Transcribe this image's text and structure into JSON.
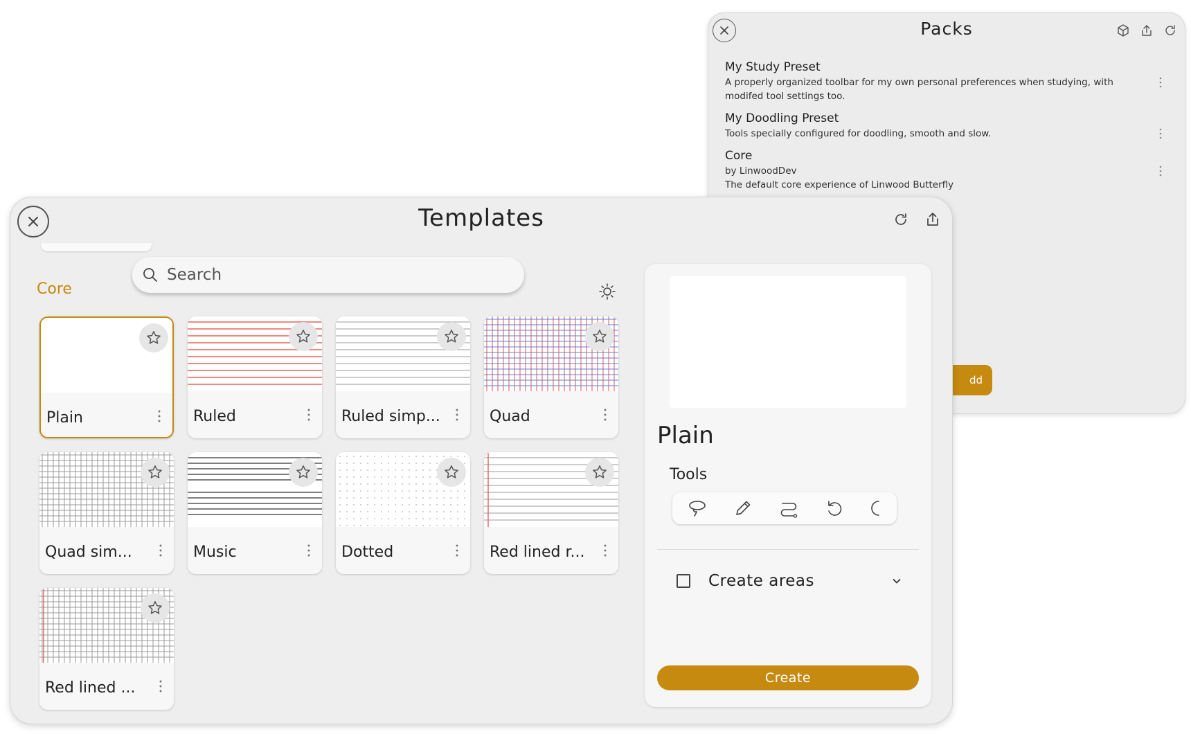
{
  "packs": {
    "title": "Packs",
    "items": [
      {
        "name": "My Study Preset",
        "lines": [
          "A properly organized toolbar for my own personal preferences when studying, with modifed tool settings too."
        ]
      },
      {
        "name": "My Doodling Preset",
        "lines": [
          "Tools specially configured for doodling, smooth and slow."
        ]
      },
      {
        "name": "Core",
        "lines": [
          "by LinwoodDev",
          "The default core experience of Linwood Butterfly"
        ]
      }
    ],
    "add_label": "dd"
  },
  "templates": {
    "title": "Templates",
    "search": {
      "placeholder": "Search",
      "value": ""
    },
    "section": "Core",
    "cards": [
      {
        "name": "Plain",
        "pattern": "plain",
        "selected": true
      },
      {
        "name": "Ruled",
        "pattern": "ruled"
      },
      {
        "name": "Ruled simp...",
        "pattern": "ruled-simple"
      },
      {
        "name": "Quad",
        "pattern": "quad"
      },
      {
        "name": "Quad sim...",
        "pattern": "quad-simple"
      },
      {
        "name": "Music",
        "pattern": "music"
      },
      {
        "name": "Dotted",
        "pattern": "dotted"
      },
      {
        "name": "Red lined r...",
        "pattern": "red-lined-ruled"
      },
      {
        "name": "Red lined ...",
        "pattern": "red-lined-quad"
      }
    ],
    "detail": {
      "name": "Plain",
      "tools_label": "Tools",
      "tools": [
        "lasso-icon",
        "pen-icon",
        "path-icon",
        "undo-icon",
        "partial-icon"
      ],
      "create_areas_label": "Create areas",
      "create_label": "Create"
    }
  },
  "colors": {
    "accent": "#c68a10",
    "ruled_red": "#e8645a",
    "quad_blue": "#5a7fe0",
    "grid_gray": "#9a9a9a"
  }
}
